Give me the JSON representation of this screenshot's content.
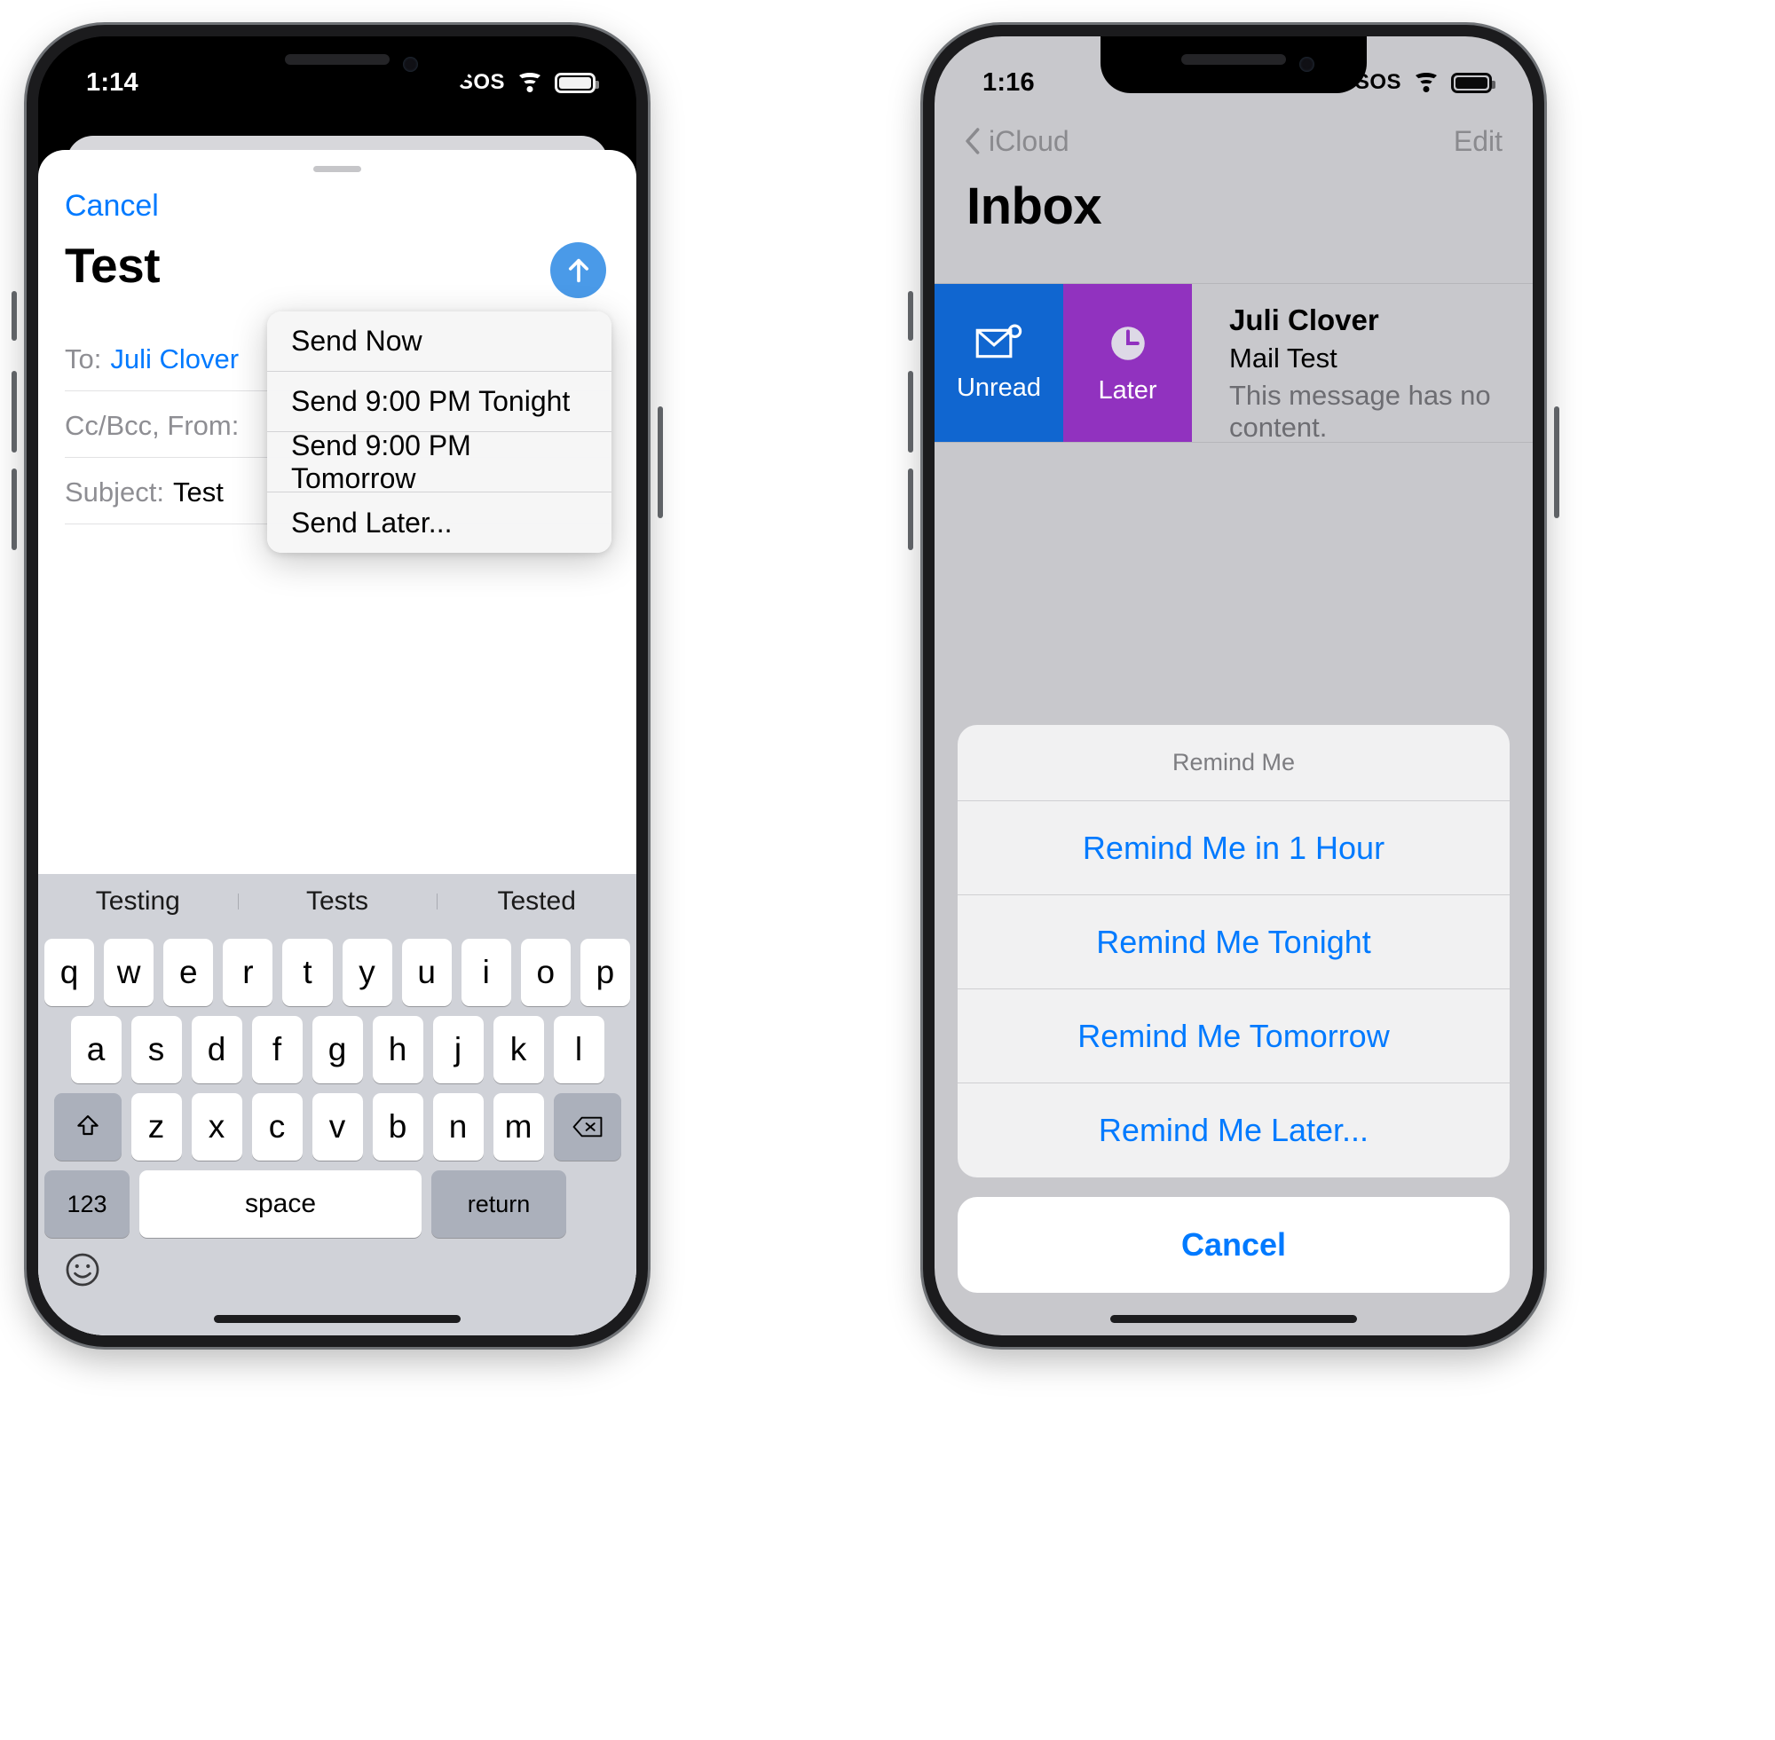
{
  "colors": {
    "accent_blue": "#007aff",
    "send_button": "#4a9ae8",
    "swipe_unread": "#1066d0",
    "swipe_later": "#9132bf",
    "mail_background": "#c8c8cc",
    "sheet_background": "#f1f1f2"
  },
  "left_phone": {
    "status_bar": {
      "time": "1:14",
      "sos": "SOS",
      "wifi_icon": "wifi-icon",
      "battery_icon": "battery-icon"
    },
    "compose": {
      "cancel_label": "Cancel",
      "title": "Test",
      "send_icon": "arrow-up-icon",
      "fields": [
        {
          "label": "To:",
          "value": "Juli Clover",
          "is_link": true
        },
        {
          "label": "Cc/Bcc, From:",
          "value": "",
          "is_link": false
        },
        {
          "label": "Subject:",
          "value": "Test",
          "is_link": false
        }
      ]
    },
    "context_menu": {
      "items": [
        "Send Now",
        "Send 9:00 PM Tonight",
        "Send 9:00 PM Tomorrow",
        "Send Later..."
      ]
    },
    "keyboard": {
      "suggestions": [
        "Testing",
        "Tests",
        "Tested"
      ],
      "row1": [
        "q",
        "w",
        "e",
        "r",
        "t",
        "y",
        "u",
        "i",
        "o",
        "p"
      ],
      "row2": [
        "a",
        "s",
        "d",
        "f",
        "g",
        "h",
        "j",
        "k",
        "l"
      ],
      "row3": [
        "z",
        "x",
        "c",
        "v",
        "b",
        "n",
        "m"
      ],
      "shift_icon": "shift-icon",
      "backspace_icon": "backspace-icon",
      "numbers_key": "123",
      "space_key": "space",
      "return_key": "return",
      "emoji_icon": "emoji-icon"
    }
  },
  "right_phone": {
    "status_bar": {
      "time": "1:16",
      "sos": "SOS",
      "wifi_icon": "wifi-icon",
      "battery_icon": "battery-icon"
    },
    "navbar": {
      "back_icon": "chevron-left-icon",
      "back_label": "iCloud",
      "edit_label": "Edit"
    },
    "page_title": "Inbox",
    "mail_row": {
      "swipe_actions": [
        {
          "label": "Unread",
          "icon": "envelope-badge-icon",
          "color": "#1066d0"
        },
        {
          "label": "Later",
          "icon": "clock-icon",
          "color": "#9132bf"
        }
      ],
      "sender": "Juli Clover",
      "subject": "Mail Test",
      "preview": "This message has no content."
    },
    "action_sheet": {
      "title": "Remind Me",
      "items": [
        "Remind Me in 1 Hour",
        "Remind Me Tonight",
        "Remind Me Tomorrow",
        "Remind Me Later..."
      ],
      "cancel_label": "Cancel"
    }
  }
}
